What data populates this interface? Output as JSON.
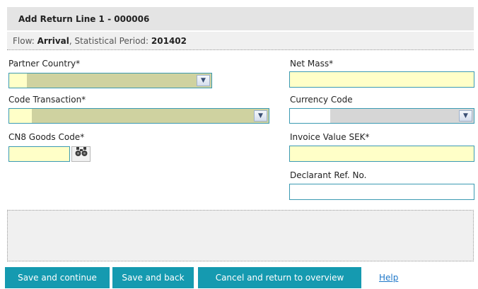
{
  "header": {
    "title": "Add Return Line 1 - 000006"
  },
  "info": {
    "flow_label": "Flow: ",
    "flow_value": "Arrival",
    "period_label": ", Statistical Period: ",
    "period_value": "201402"
  },
  "form": {
    "partner_country": {
      "label": "Partner Country*",
      "value": ""
    },
    "code_transaction": {
      "label": "Code Transaction*",
      "value": ""
    },
    "cn8_goods_code": {
      "label": "CN8 Goods Code*",
      "value": ""
    },
    "net_mass": {
      "label": "Net Mass*",
      "value": ""
    },
    "currency_code": {
      "label": "Currency Code",
      "value": ""
    },
    "invoice_value": {
      "label": "Invoice Value SEK*",
      "value": ""
    },
    "declarant_ref": {
      "label": "Declarant Ref. No.",
      "value": ""
    }
  },
  "buttons": {
    "save_continue": "Save and continue",
    "save_back": "Save and back",
    "cancel": "Cancel and return to overview",
    "help": "Help"
  },
  "icons": {
    "dropdown": "chevron-down-icon",
    "search": "binoculars-icon"
  },
  "colors": {
    "required_field": "#ffffc8",
    "field_border": "#3b9ab2",
    "button": "#159ab0",
    "link": "#1e77c9"
  }
}
